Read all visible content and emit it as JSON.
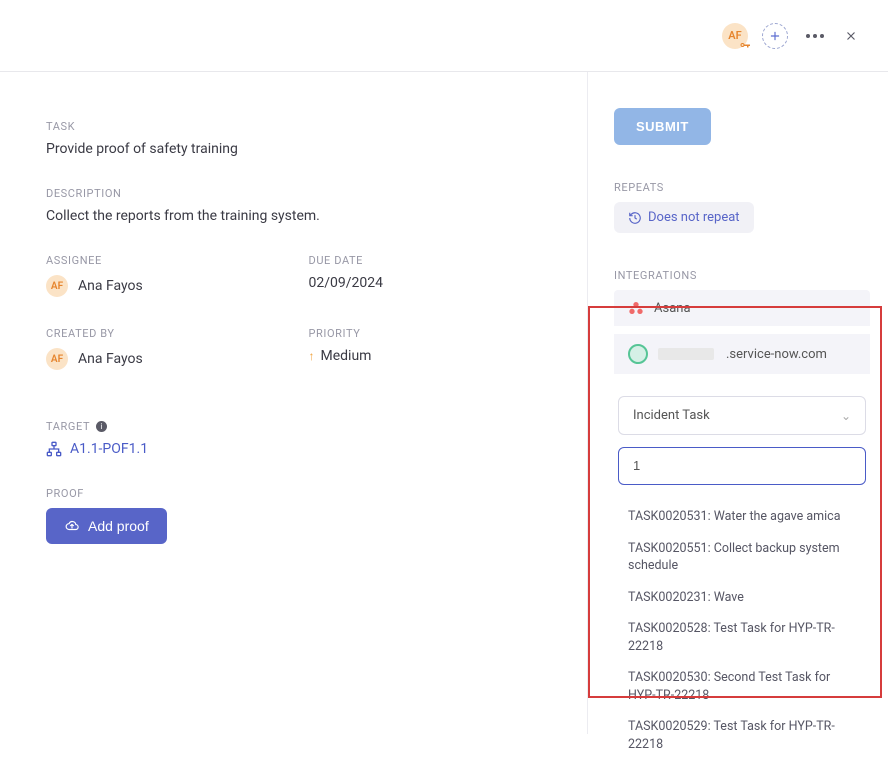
{
  "header": {
    "avatar_initials": "AF"
  },
  "task": {
    "label": "TASK",
    "title": "Provide proof of safety training",
    "description_label": "DESCRIPTION",
    "description": "Collect the reports from the training system.",
    "assignee_label": "ASSIGNEE",
    "assignee_name": "Ana Fayos",
    "assignee_initials": "AF",
    "due_date_label": "DUE DATE",
    "due_date": "02/09/2024",
    "created_by_label": "CREATED BY",
    "created_by_name": "Ana Fayos",
    "created_by_initials": "AF",
    "priority_label": "PRIORITY",
    "priority": "Medium",
    "target_label": "TARGET",
    "target_value": "A1.1-POF1.1",
    "proof_label": "PROOF",
    "add_proof": "Add proof"
  },
  "side": {
    "submit": "SUBMIT",
    "repeats_label": "REPEATS",
    "repeats_value": "Does not repeat",
    "integrations_label": "INTEGRATIONS",
    "asana_label": "Asana",
    "sn_domain": ".service-now.com",
    "select_value": "Incident Task",
    "search_value": "1",
    "results": [
      "TASK0020531: Water the agave amica",
      "TASK0020551: Collect backup system schedule",
      "TASK0020231: Wave",
      "TASK0020528: Test Task for HYP-TR-22218",
      "TASK0020530: Second Test Task for HYP-TR-22218",
      "TASK0020529: Test Task for HYP-TR-22218"
    ]
  }
}
